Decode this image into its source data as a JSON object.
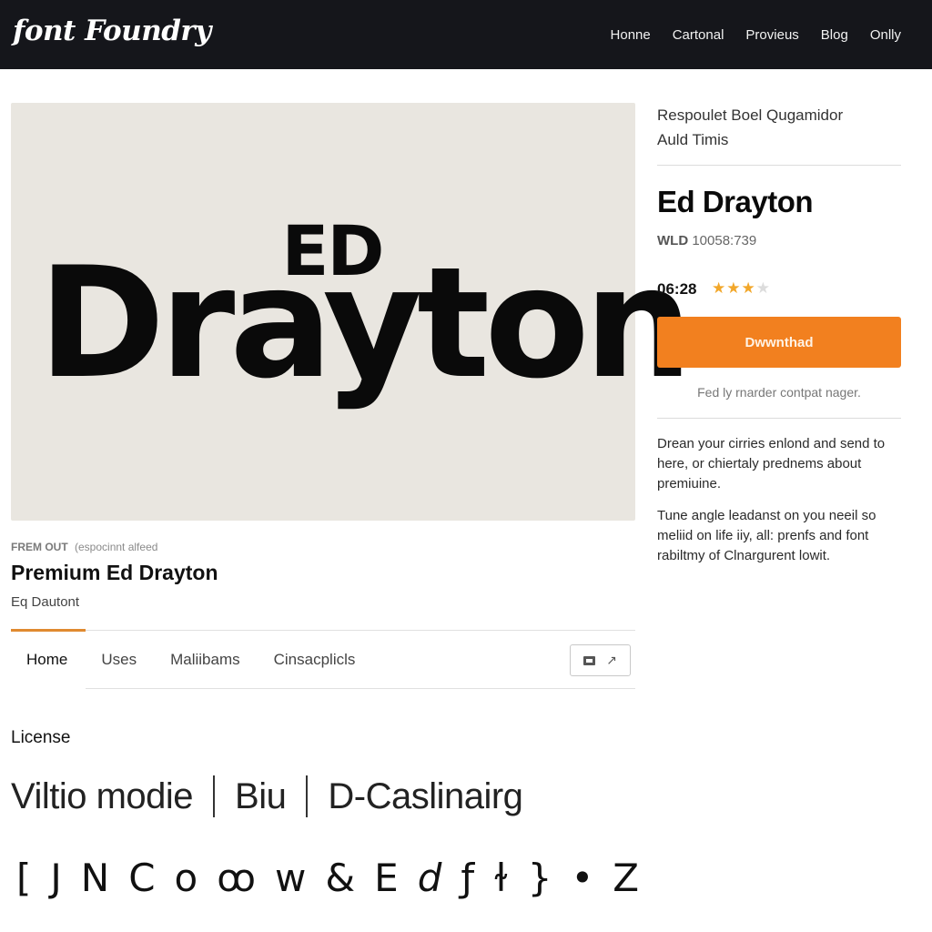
{
  "header": {
    "logo": "font Foundry",
    "nav": [
      "Honne",
      "Cartonal",
      "Provieus",
      "Blog",
      "Onlly"
    ]
  },
  "preview": {
    "small_text": "ED",
    "large_text": "Drayton"
  },
  "font_meta": {
    "label_bold": "FREM OUT",
    "label_rest": "(espocinnt alfeed",
    "title": "Premium Ed Drayton",
    "subtitle": "Eq Dautont"
  },
  "tabs": {
    "items": [
      "Home",
      "Uses",
      "Maliibams",
      "Cinsacplicls"
    ],
    "active": "Home"
  },
  "tab_tools": {
    "icons": [
      "image-icon",
      "share-icon"
    ]
  },
  "license": {
    "label": "License",
    "options": [
      "Viltio modie",
      "Biu",
      "D-Caslinairg"
    ]
  },
  "glyph_samples": [
    "[",
    "J",
    "N",
    "C",
    "o",
    "ꝏ",
    "w",
    "&",
    "E",
    "d",
    "ƒ",
    "ɫ",
    "}",
    "•",
    "Z"
  ],
  "sidebar": {
    "top_line1": "Respoulet Boel Qugamidor",
    "top_line2": "Auld Timis",
    "title": "Ed Drayton",
    "code_bold": "WLD",
    "code_rest": "10058:739",
    "time": "06:28",
    "rating": 3,
    "rating_max": 4,
    "download_label": "Dwwnthad",
    "note": "Fed ly rnarder contpat nager.",
    "para1": "Drean your cirries enlond and send to here, or chiertaly prednems about premiuine.",
    "para2": "Tune angle leadanst on you neeil so meliid on life iiy, all: prenfs and font rabiltmy of Clnargurent lowit."
  },
  "colors": {
    "accent": "#f2801f",
    "topbar": "#15161b",
    "preview_bg": "#e9e6e0",
    "star": "#f2a72a"
  }
}
